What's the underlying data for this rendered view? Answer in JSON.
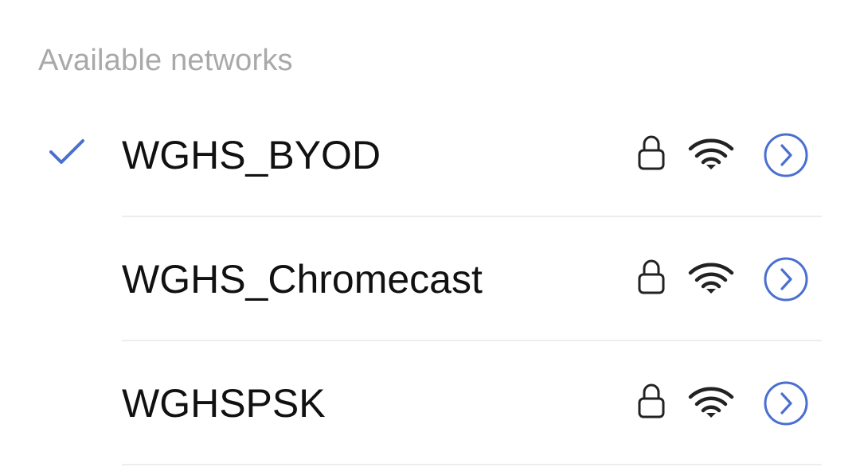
{
  "section": {
    "title": "Available networks"
  },
  "networks": [
    {
      "ssid": "WGHS_BYOD",
      "connected": true,
      "secured": true,
      "signal_icon": "wifi-full-icon"
    },
    {
      "ssid": "WGHS_Chromecast",
      "connected": false,
      "secured": true,
      "signal_icon": "wifi-full-icon"
    },
    {
      "ssid": "WGHSPSK",
      "connected": false,
      "secured": true,
      "signal_icon": "wifi-full-icon"
    }
  ],
  "colors": {
    "accent": "#4a6fd1",
    "header_text": "#a9a9a9",
    "primary_text": "#111111",
    "icon": "#222222",
    "divider": "#ededed"
  }
}
